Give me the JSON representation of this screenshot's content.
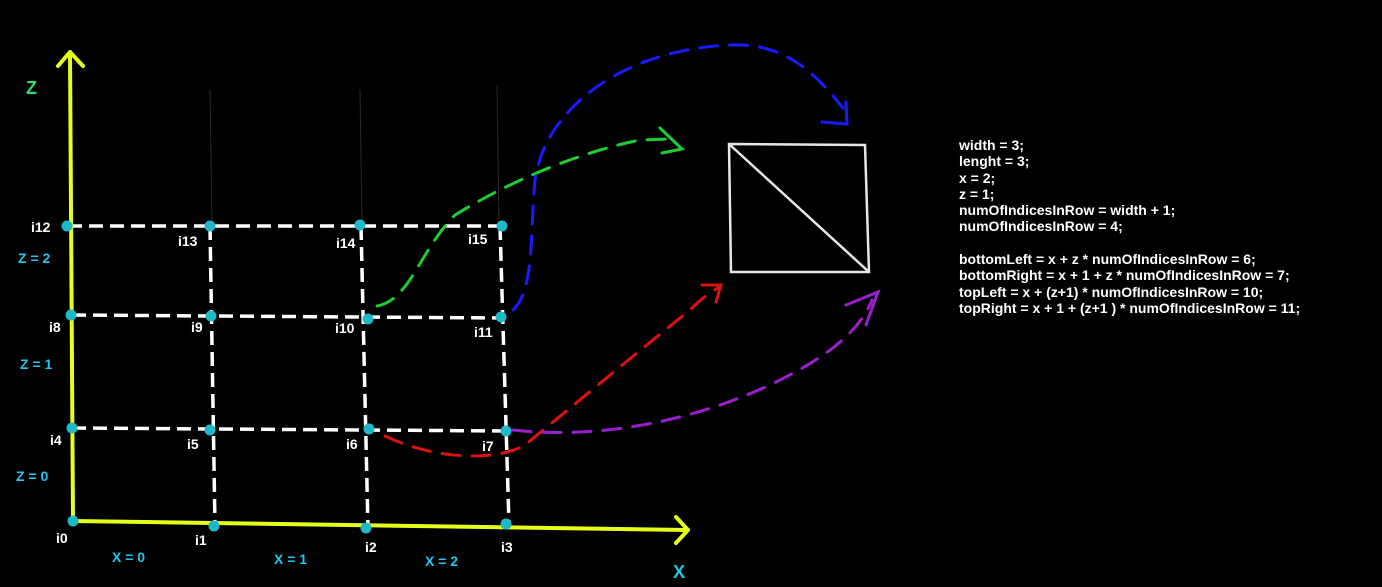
{
  "axes": {
    "x_label": "X",
    "z_label": "Z",
    "axis_color": "#e6ff1a",
    "label_color": "#22e07a",
    "x_label_color": "#22c8e6"
  },
  "column_labels": [
    "X = 0",
    "X = 1",
    "X = 2"
  ],
  "row_labels": [
    "Z = 0",
    "Z = 1",
    "Z = 2"
  ],
  "vertices": [
    "i0",
    "i1",
    "i2",
    "i3",
    "i4",
    "i5",
    "i6",
    "i7",
    "i8",
    "i9",
    "i10",
    "i11",
    "i12",
    "i13",
    "i14",
    "i15"
  ],
  "colors": {
    "grid": "#ffffff",
    "vertex": "#1fb8c8",
    "axis_text": "#1ec8f0",
    "green": "#1ecc33",
    "blue": "#1a1aff",
    "red": "#dd1111",
    "purple": "#9b1ecc",
    "quad": "#e6e6e6"
  },
  "code_lines": [
    "width = 3;",
    "lenght = 3;",
    "x = 2;",
    "z = 1;",
    "numOfIndicesInRow = width + 1;",
    "numOfIndicesInRow = 4;",
    "",
    "bottomLeft = x + z * numOfIndicesInRow = 6;",
    "bottomRight = x + 1 + z * numOfIndicesInRow = 7;",
    "topLeft = x + (z+1) * numOfIndicesInRow = 10;",
    "topRight = x + 1 + (z+1 ) * numOfIndicesInRow = 11;"
  ]
}
